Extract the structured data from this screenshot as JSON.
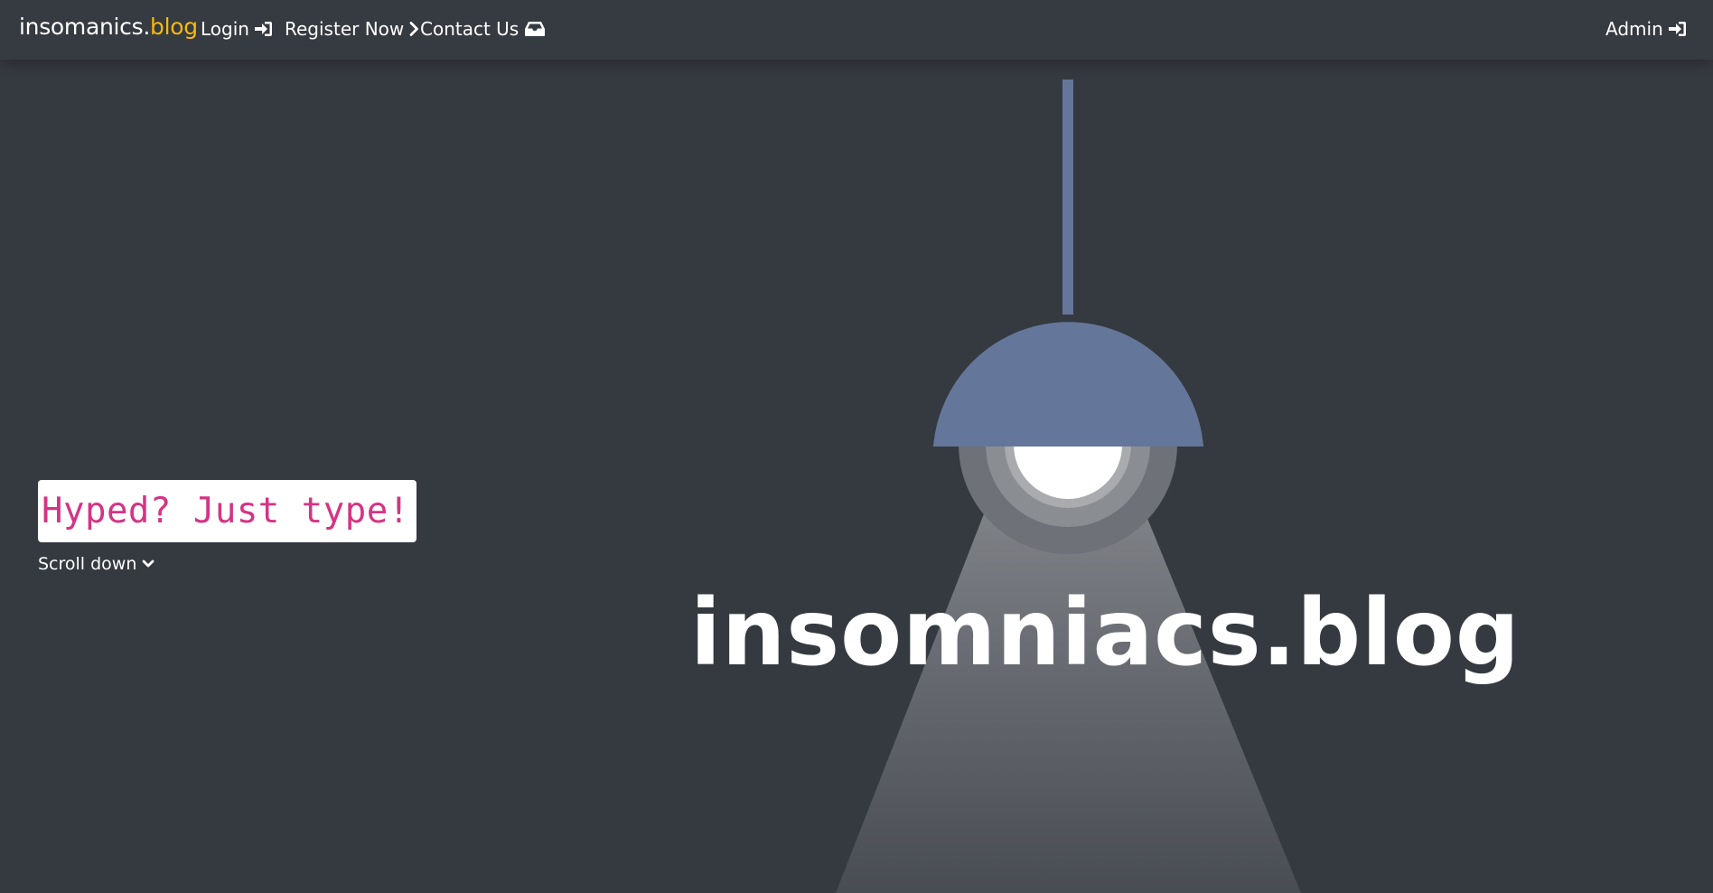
{
  "nav": {
    "brand_main": "insomanics.",
    "brand_accent": "blog",
    "login_label": "Login",
    "register_label": "Register Now",
    "contact_label": "Contact Us",
    "admin_label": "Admin"
  },
  "hero": {
    "tagline": "Hyped? Just type!",
    "scroll_label": "Scroll down",
    "title": "insomniacs.blog"
  },
  "colors": {
    "background": "#353940",
    "accent": "#f5b90f",
    "lamp": "#64779a",
    "tagline_text": "#d63384"
  },
  "icons": {
    "login": "sign-in-icon",
    "register": "chevron-right-icon",
    "contact": "inbox-icon",
    "admin": "sign-in-icon",
    "scroll": "chevron-down-icon"
  }
}
